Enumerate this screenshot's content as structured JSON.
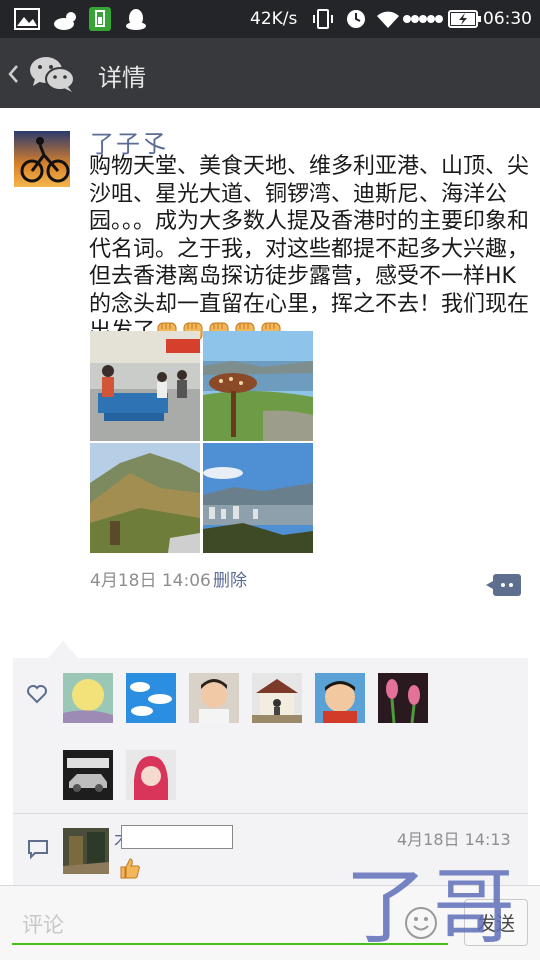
{
  "status_bar": {
    "network_speed": "42K/s",
    "time": "06:30"
  },
  "header": {
    "back_icon": "chevron-left-icon",
    "app_icon": "wechat-icon",
    "title": "详情"
  },
  "post": {
    "username": "了子孓",
    "text": "购物天堂、美食天地、维多利亚港、山顶、尖沙咀、星光大道、铜锣湾、迪斯尼、海洋公园。。。成为大多数人提及香港时的主要印象和代名词。之于我，对这些都提不起多大兴趣，但去香港离岛探访徒步露营，感受不一样HK的念头却一直留在心里，挥之不去！我们现在出发了",
    "emoji_count": 5,
    "emoji_icon": "raised-fist-icon",
    "photos": [
      "airport-waiting-hall",
      "seaside-sign-post",
      "mountain-ridge",
      "city-skyline-view"
    ],
    "time": "4月18日 14:06",
    "delete_label": "删除"
  },
  "likes": {
    "icon": "heart-icon",
    "avatars": [
      "full-moon",
      "blue-sky-clouds",
      "baby-portrait",
      "house-portrait",
      "child-portrait",
      "pink-flowers",
      "car-poster",
      "red-hair-girl"
    ]
  },
  "comment": {
    "icon": "comment-bubble-icon",
    "name_visible_char": "木",
    "time": "4月18日 14:13",
    "content_icon": "thumbs-up-icon"
  },
  "input": {
    "placeholder": "评论",
    "emoji_icon": "smiley-icon",
    "send_label": "发送"
  },
  "watermark": "了哥",
  "colors": {
    "status_bar": "#232529",
    "title_bar": "#37393d",
    "link": "#5b6b94",
    "input_underline": "#45c01a"
  }
}
